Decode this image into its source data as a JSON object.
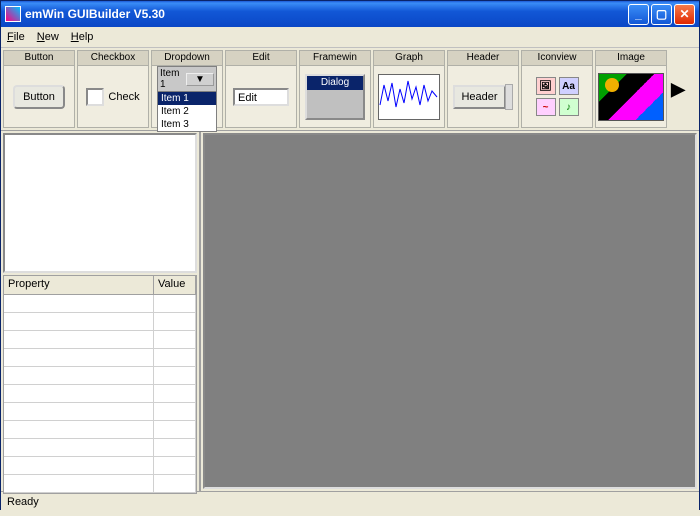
{
  "window": {
    "title": "emWin GUIBuilder V5.30"
  },
  "menubar": {
    "file": "File",
    "new": "New",
    "help": "Help"
  },
  "toolbar": {
    "cells": [
      {
        "name": "button",
        "title": "Button",
        "sample_text": "Button"
      },
      {
        "name": "checkbox",
        "title": "Checkbox",
        "sample_text": "Check"
      },
      {
        "name": "dropdown",
        "title": "Dropdown",
        "selected": "Item 1",
        "opt1": "Item 1",
        "opt2": "Item 2",
        "opt3": "Item 3"
      },
      {
        "name": "edit",
        "title": "Edit",
        "sample_text": "Edit"
      },
      {
        "name": "framewin",
        "title": "Framewin",
        "sample_text": "Dialog"
      },
      {
        "name": "graph",
        "title": "Graph"
      },
      {
        "name": "header",
        "title": "Header",
        "sample_text": "Header"
      },
      {
        "name": "iconview",
        "title": "Iconview"
      },
      {
        "name": "image",
        "title": "Image"
      }
    ],
    "scroll_arrow": "▶"
  },
  "property_grid": {
    "col_property": "Property",
    "col_value": "Value"
  },
  "status": {
    "text": "Ready"
  },
  "iconview_samples": {
    "a": "🖼",
    "b": "Aa",
    "c": "~",
    "d": "♪"
  },
  "colors": {
    "titlebar": "#1257d6",
    "selection": "#0a246a",
    "canvas": "#808080"
  }
}
